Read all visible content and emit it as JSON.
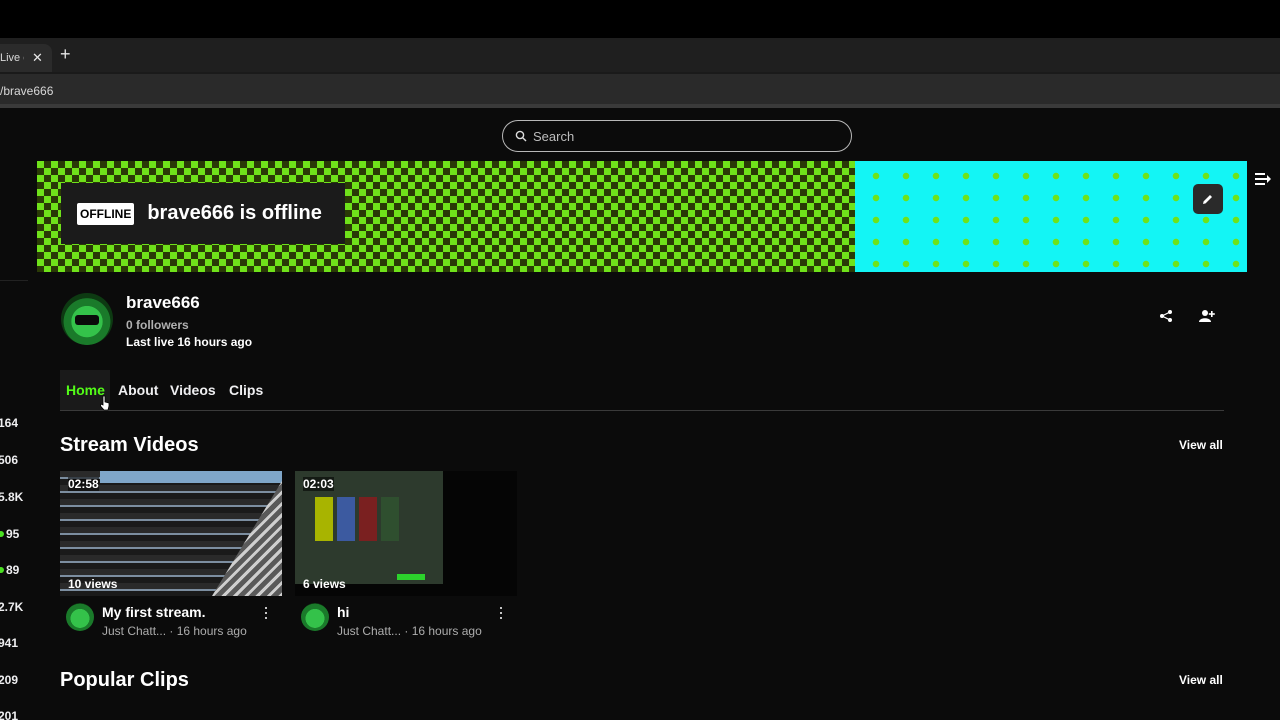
{
  "browser": {
    "tab_title": "Live c",
    "tab_close": "✕",
    "new_tab": "+",
    "address": "/brave666"
  },
  "search": {
    "placeholder": "Search"
  },
  "banner": {
    "offline_badge": "OFFLINE",
    "offline_text": "brave666 is offline"
  },
  "left_rail": {
    "counts": [
      {
        "label": "164",
        "live": false
      },
      {
        "label": "506",
        "live": false
      },
      {
        "label": "5.8K",
        "live": false
      },
      {
        "label": "95",
        "live": true
      },
      {
        "label": "89",
        "live": true
      },
      {
        "label": "2.7K",
        "live": false
      },
      {
        "label": "941",
        "live": false
      },
      {
        "label": "209",
        "live": false
      },
      {
        "label": "201",
        "live": false
      }
    ]
  },
  "channel": {
    "name": "brave666",
    "followers": "0 followers",
    "last_live": "Last live 16 hours ago"
  },
  "tabs": [
    "Home",
    "About",
    "Videos",
    "Clips"
  ],
  "active_tab": "Home",
  "sections": {
    "stream_videos": {
      "title": "Stream Videos",
      "view_all": "View all"
    },
    "popular_clips": {
      "title": "Popular Clips",
      "view_all": "View all"
    }
  },
  "videos": [
    {
      "duration": "02:58",
      "views": "10 views",
      "title": "My first stream.",
      "channel": "Just Chatt...",
      "age": " · 16 hours ago"
    },
    {
      "duration": "02:03",
      "views": "6 views",
      "title": "hi",
      "channel": "Just Chatt...",
      "age": " · 16 hours ago"
    }
  ],
  "colors": {
    "accent": "#53fc18",
    "background": "#0b0b0b",
    "banner_cyan": "#13f5f5"
  }
}
